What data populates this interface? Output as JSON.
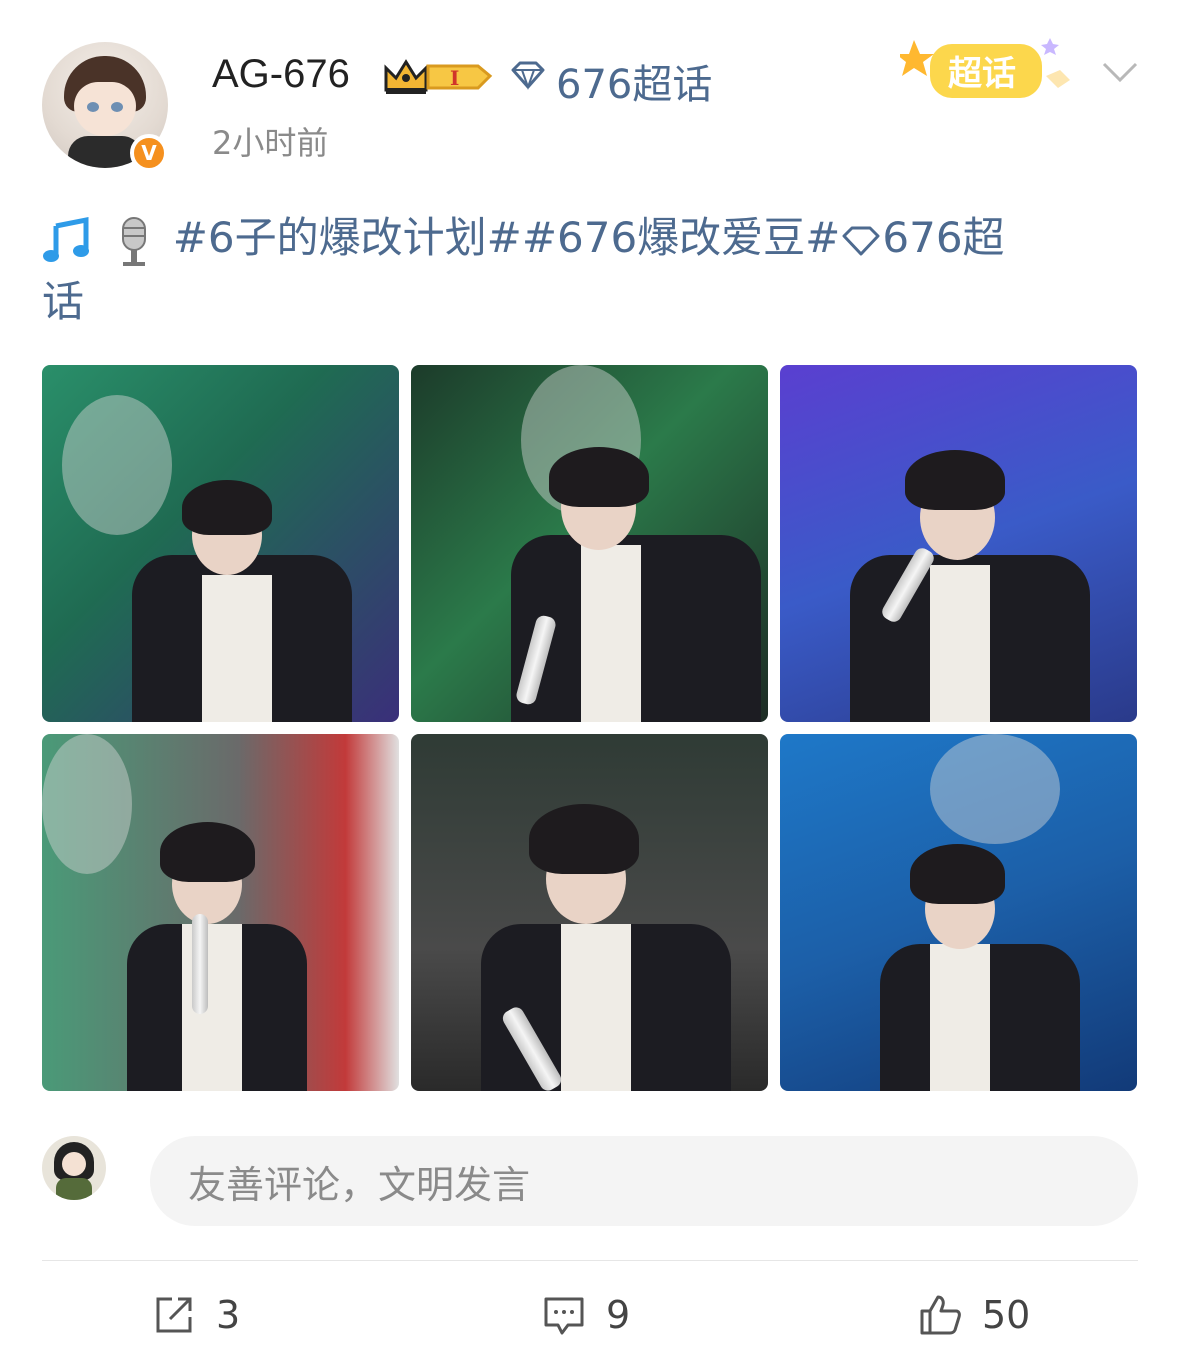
{
  "author": {
    "name": "AG-676",
    "verified_badge": "V",
    "timestamp": "2小时前",
    "level_badge": "I"
  },
  "topic": {
    "label": "676超话"
  },
  "super_topic_badge": {
    "label": "超话"
  },
  "post": {
    "emoji_1": "music-note-icon",
    "emoji_2": "microphone-icon",
    "tag_1": "#6子的爆改计划#",
    "tag_2": "#676爆改爱豆#",
    "topic_tail_1": "676超",
    "topic_tail_2": "话"
  },
  "photos": [
    {
      "bg": "#2c7a5a"
    },
    {
      "bg": "#2b5b3d"
    },
    {
      "bg": "#4a45b8"
    },
    {
      "bg": "#3a6b52"
    },
    {
      "bg": "#343434"
    },
    {
      "bg": "#1f5fb0"
    }
  ],
  "comment_box": {
    "placeholder": "友善评论，文明发言"
  },
  "actions": {
    "share_count": "3",
    "comment_count": "9",
    "like_count": "50"
  },
  "colors": {
    "link": "#4d6a8f",
    "verified": "#f5901e",
    "gold": "#f2b533"
  }
}
